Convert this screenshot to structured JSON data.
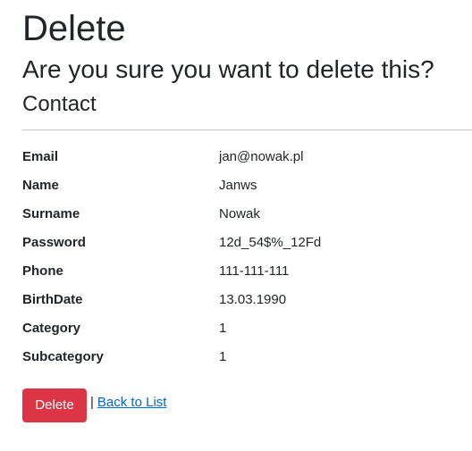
{
  "page": {
    "title": "Delete",
    "question": "Are you sure you want to delete this?",
    "entity": "Contact"
  },
  "details": [
    {
      "label": "Email",
      "value": "jan@nowak.pl"
    },
    {
      "label": "Name",
      "value": "Janws"
    },
    {
      "label": "Surname",
      "value": "Nowak"
    },
    {
      "label": "Password",
      "value": "12d_54$%_12Fd"
    },
    {
      "label": "Phone",
      "value": "111-111-111"
    },
    {
      "label": "BirthDate",
      "value": "13.03.1990"
    },
    {
      "label": "Category",
      "value": "1"
    },
    {
      "label": "Subcategory",
      "value": "1"
    }
  ],
  "actions": {
    "delete_label": "Delete",
    "separator": "|",
    "back_label": "Back to List"
  },
  "colors": {
    "danger": "#dc3545",
    "link": "#0366d6",
    "text": "#212529"
  }
}
